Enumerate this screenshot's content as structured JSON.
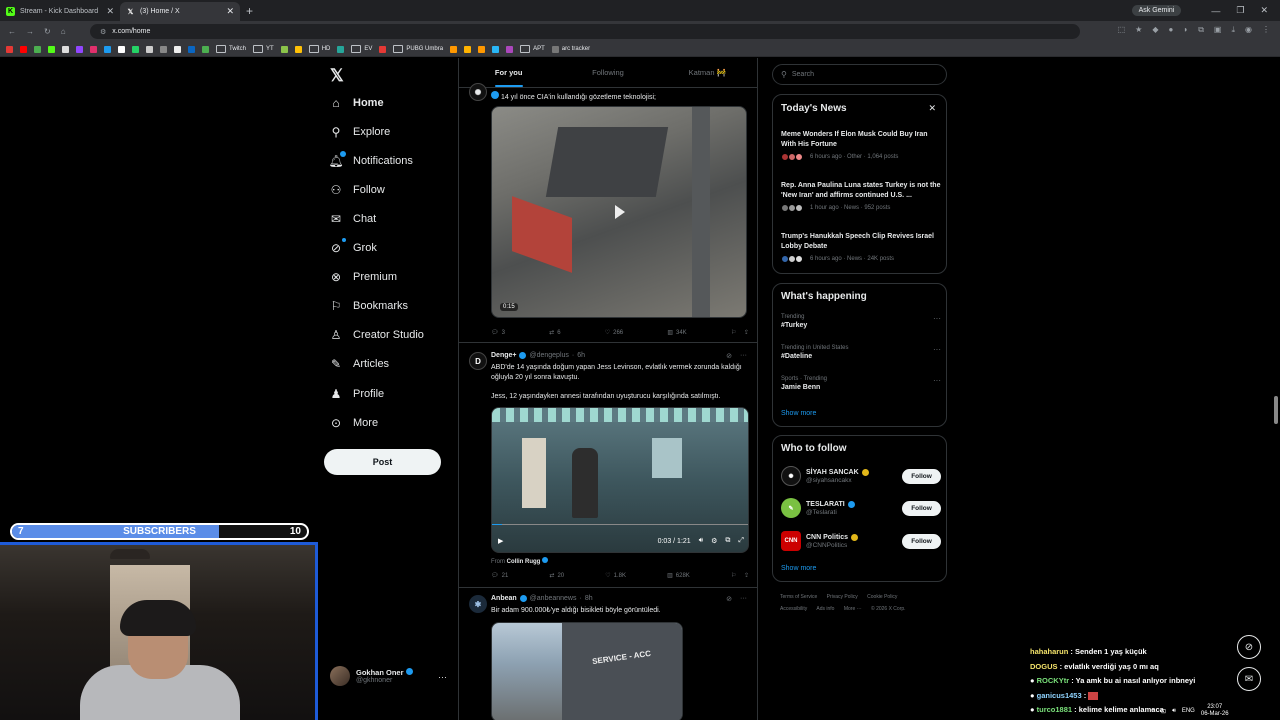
{
  "browser": {
    "tabs": [
      {
        "title": "Stream - Kick Dashboard",
        "active": false
      },
      {
        "title": "(3) Home / X",
        "active": true
      }
    ],
    "gemini_label": "Ask Gemini",
    "url": "x.com/home",
    "bookmarks": [
      "Twitch",
      "YT",
      "HD",
      "EV",
      "PUBG Umbra",
      "APT",
      "arc tracker"
    ]
  },
  "nav": {
    "items": [
      {
        "label": "Home",
        "icon": "home-icon"
      },
      {
        "label": "Explore",
        "icon": "search-icon"
      },
      {
        "label": "Notifications",
        "icon": "bell-icon"
      },
      {
        "label": "Follow",
        "icon": "person-add-icon"
      },
      {
        "label": "Chat",
        "icon": "mail-icon"
      },
      {
        "label": "Grok",
        "icon": "grok-icon"
      },
      {
        "label": "Premium",
        "icon": "x-premium-icon"
      },
      {
        "label": "Bookmarks",
        "icon": "bookmark-icon"
      },
      {
        "label": "Creator Studio",
        "icon": "creator-icon"
      },
      {
        "label": "Articles",
        "icon": "articles-icon"
      },
      {
        "label": "Profile",
        "icon": "person-icon"
      },
      {
        "label": "More",
        "icon": "more-circle-icon"
      }
    ],
    "post_label": "Post",
    "profile": {
      "name": "Gokhan Oner",
      "handle": "@gkhnoner"
    }
  },
  "feed": {
    "tabs": [
      "For you",
      "Following",
      "Katman 🚧"
    ],
    "posts": [
      {
        "text": "14 yıl önce CIA'in kullandığı gözetleme teknolojisi;",
        "video_time": "0:15",
        "replies": "3",
        "reposts": "6",
        "likes": "266",
        "views": "34K"
      },
      {
        "name": "Denge+",
        "handle": "@dengeplus",
        "time": "6h",
        "text1": "ABD'de 14 yaşında doğum yapan Jess Levinson, evlatlık vermek zorunda kaldığı oğluyla 20 yıl sonra kavuştu.",
        "text2": "Jess, 12 yaşındayken annesi tarafından uyuşturucu karşılığında satılmıştı.",
        "video_time": "0:03 / 1:21",
        "from_label": "From",
        "from_name": "Collin Rugg",
        "replies": "21",
        "reposts": "20",
        "likes": "1.8K",
        "views": "628K"
      },
      {
        "name": "Anbean",
        "handle": "@anbeannews",
        "time": "8h",
        "text": "Bir adam 900.000₺'ye aldığı bisikleti böyle görüntüledi.",
        "storefront": "SERVICE - ACC"
      }
    ]
  },
  "right": {
    "search_placeholder": "Search",
    "todays_news": {
      "title": "Today's News",
      "items": [
        {
          "title": "Meme Wonders If Elon Musk Could Buy Iran With His Fortune",
          "meta": "6 hours ago · Other · 1,064 posts"
        },
        {
          "title": "Rep. Anna Paulina Luna states Turkey is not the 'New Iran' and affirms continued U.S. ...",
          "meta": "1 hour ago · News · 952 posts"
        },
        {
          "title": "Trump's Hanukkah Speech Clip Revives Israel Lobby Debate",
          "meta": "6 hours ago · News · 24K posts"
        }
      ]
    },
    "whats_happening": {
      "title": "What's happening",
      "items": [
        {
          "context": "Trending",
          "topic": "#Turkey"
        },
        {
          "context": "Trending in United States",
          "topic": "#Dateline"
        },
        {
          "context": "Sports · Trending",
          "topic": "Jamie Benn"
        }
      ],
      "show_more": "Show more"
    },
    "who_to_follow": {
      "title": "Who to follow",
      "items": [
        {
          "name": "SİYAH SANCAK",
          "handle": "@siyahsancakx",
          "badge": "gold"
        },
        {
          "name": "TESLARATI",
          "handle": "@Teslarati",
          "badge": "blue"
        },
        {
          "name": "CNN Politics",
          "handle": "@CNNPolitics",
          "badge": "gold"
        }
      ],
      "follow_label": "Follow",
      "show_more": "Show more"
    },
    "footer": {
      "line1": [
        "Terms of Service",
        "Privacy Policy",
        "Cookie Policy"
      ],
      "line2": [
        "Accessibility",
        "Ads info",
        "More ···",
        "© 2026 X Corp."
      ]
    }
  },
  "stream": {
    "sub_current": "7",
    "sub_label": "SUBSCRIBERS",
    "sub_goal": "10",
    "sub_progress": 0.7,
    "chat": [
      {
        "user": "hahaharun",
        "msg": " : Senden 1 yaş küçük"
      },
      {
        "user": "DOGUS",
        "msg": " : evlatlık verdiği yaş 0 mı aq"
      },
      {
        "user": "ROCKYtr",
        "msg": " : Ya amk bu ai nasıl anlıyor inbneyi"
      },
      {
        "user": "ganicus1453",
        "msg": " : "
      },
      {
        "user": "turco1881",
        "msg": " : kelime kelime anlamaca"
      }
    ]
  },
  "system": {
    "lang": "ENG",
    "time": "23:07",
    "date": "06-Mar-26"
  },
  "colors": {
    "accent": "#1d9bf0",
    "background": "#000000",
    "sub_fill": "#5b8de8",
    "cam_border": "#1e5bd8"
  }
}
